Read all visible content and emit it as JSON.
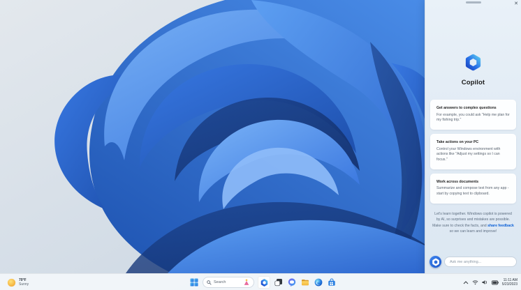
{
  "copilot": {
    "title": "Copilot",
    "close_glyph": "✕",
    "cards": [
      {
        "title": "Get answers to complex questions",
        "body": "For example, you could ask \"Help me plan for my fishing trip.\""
      },
      {
        "title": "Take actions on your PC",
        "body": "Control your Windows environment with actions like \"Adjust my settings so I can focus.\""
      },
      {
        "title": "Work across documents",
        "body": "Summarize and compose text from any app - start by copying text to clipboard."
      }
    ],
    "disclaimer": {
      "before": "Let's learn together. Windows copilot is powered by AI, so surprises and mistakes are possible. Make sure to check the facts, and ",
      "link": "share feedback",
      "after": " so we can learn and improve!"
    },
    "input": {
      "placeholder": "Ask me anything..."
    }
  },
  "taskbar": {
    "weather": {
      "temperature": "70°F",
      "condition": "Sunny"
    },
    "search": {
      "placeholder": "Search"
    },
    "pinned": [
      "Start",
      "Search",
      "Copilot",
      "Task view",
      "Chat",
      "File Explorer",
      "Microsoft Edge",
      "Microsoft Store"
    ],
    "tray": {
      "time": "11:11 AM",
      "date": "5/23/2023"
    }
  },
  "colors": {
    "accent": "#0b5fd7",
    "bloom_blue": "#2e6fd8",
    "panel_bg": "#e3edf6"
  }
}
